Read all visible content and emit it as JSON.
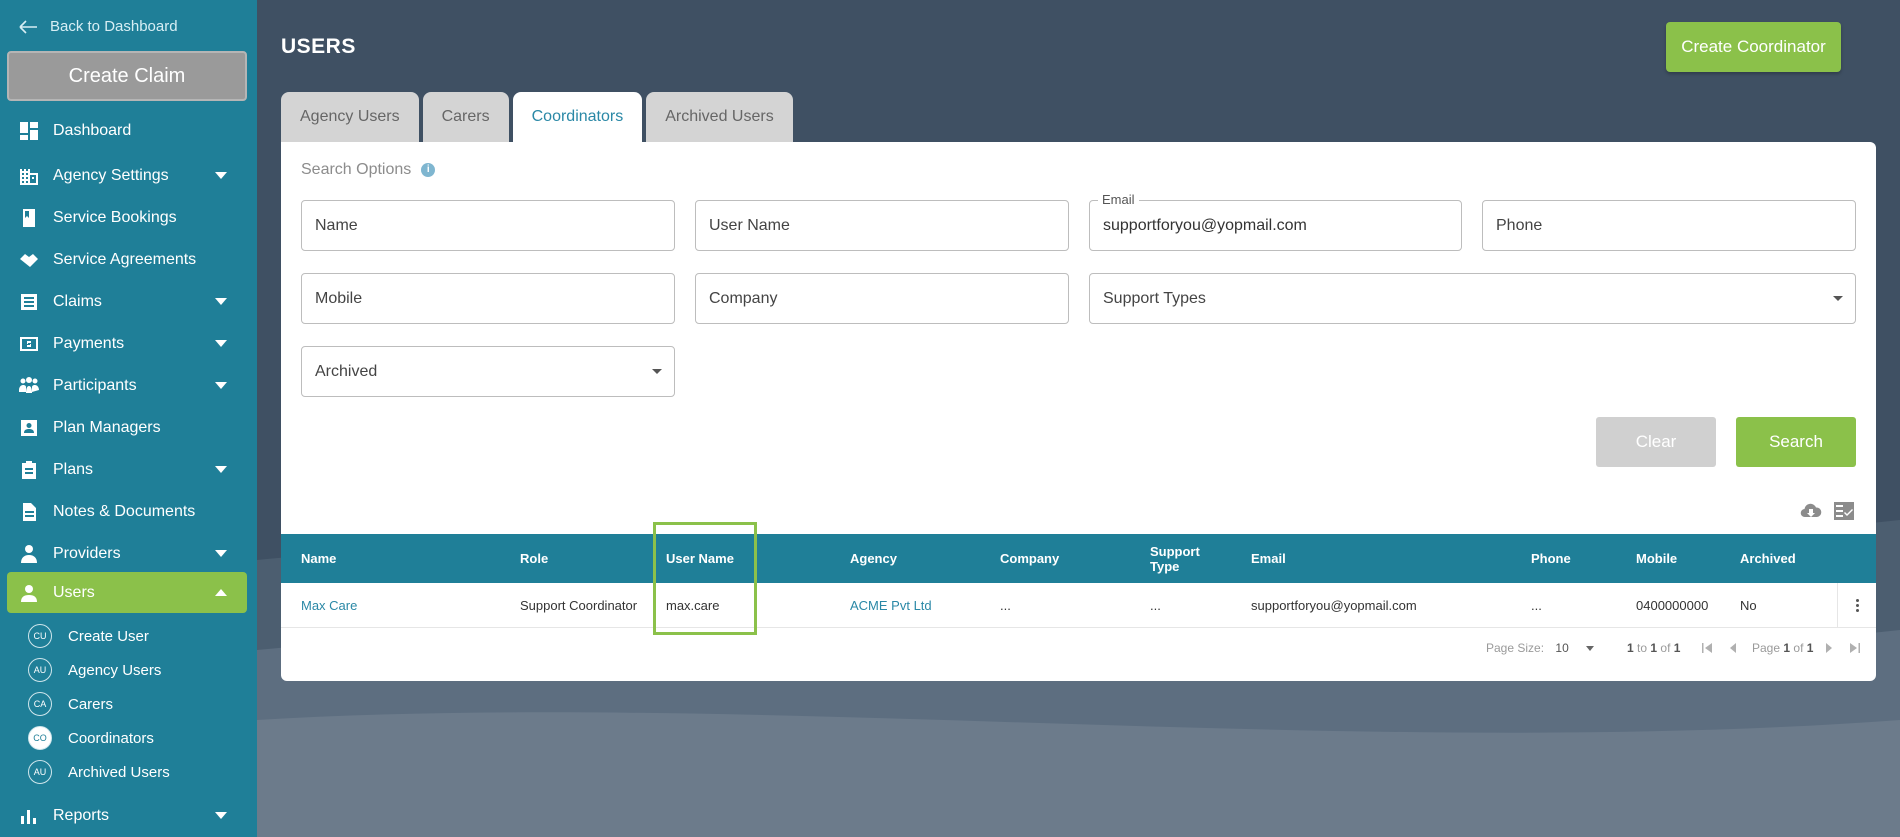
{
  "sidebar": {
    "back_label": "Back to Dashboard",
    "create_claim_label": "Create Claim",
    "items": [
      {
        "label": "Dashboard",
        "icon": "dashboard-icon",
        "expandable": false
      },
      {
        "label": "Agency Settings",
        "icon": "building-icon",
        "expandable": true
      },
      {
        "label": "Service Bookings",
        "icon": "bookmark-icon",
        "expandable": false
      },
      {
        "label": "Service Agreements",
        "icon": "handshake-icon",
        "expandable": false
      },
      {
        "label": "Claims",
        "icon": "list-icon",
        "expandable": true
      },
      {
        "label": "Payments",
        "icon": "money-icon",
        "expandable": true
      },
      {
        "label": "Participants",
        "icon": "people-icon",
        "expandable": true
      },
      {
        "label": "Plan Managers",
        "icon": "person-card-icon",
        "expandable": false
      },
      {
        "label": "Plans",
        "icon": "clipboard-icon",
        "expandable": true
      },
      {
        "label": "Notes & Documents",
        "icon": "document-icon",
        "expandable": false
      },
      {
        "label": "Providers",
        "icon": "provider-icon",
        "expandable": true
      },
      {
        "label": "Users",
        "icon": "user-icon",
        "expandable": true,
        "active": true
      },
      {
        "label": "Reports",
        "icon": "bar-chart-icon",
        "expandable": true
      }
    ],
    "sub_items": [
      {
        "badge": "CU",
        "label": "Create User"
      },
      {
        "badge": "AU",
        "label": "Agency Users"
      },
      {
        "badge": "CA",
        "label": "Carers"
      },
      {
        "badge": "CO",
        "label": "Coordinators",
        "active": true
      },
      {
        "badge": "AU",
        "label": "Archived Users"
      }
    ]
  },
  "header": {
    "title": "USERS",
    "create_button": "Create Coordinator"
  },
  "tabs": [
    "Agency Users",
    "Carers",
    "Coordinators",
    "Archived Users"
  ],
  "active_tab": "Coordinators",
  "search": {
    "title": "Search Options",
    "fields": {
      "name": {
        "placeholder": "Name",
        "value": ""
      },
      "username": {
        "placeholder": "User Name",
        "value": ""
      },
      "email": {
        "label": "Email",
        "value": "supportforyou@yopmail.com"
      },
      "phone": {
        "placeholder": "Phone",
        "value": ""
      },
      "mobile": {
        "placeholder": "Mobile",
        "value": ""
      },
      "company": {
        "placeholder": "Company",
        "value": ""
      },
      "support_types": {
        "placeholder": "Support Types",
        "value": ""
      },
      "archived": {
        "placeholder": "Archived",
        "value": ""
      }
    },
    "clear_label": "Clear",
    "search_label": "Search"
  },
  "table": {
    "columns": [
      "Name",
      "Role",
      "User Name",
      "Agency",
      "Company",
      "Support Type",
      "Email",
      "Phone",
      "Mobile",
      "Archived"
    ],
    "rows": [
      {
        "name": "Max Care",
        "role": "Support Coordinator",
        "username": "max.care",
        "agency": "ACME Pvt Ltd",
        "company": "...",
        "support_type": "...",
        "email": "supportforyou@yopmail.com",
        "phone": "...",
        "mobile": "0400000000",
        "archived": "No"
      }
    ]
  },
  "pagination": {
    "page_size_label": "Page Size:",
    "page_size": "10",
    "from": "1",
    "to_word": "to",
    "to": "1",
    "of_word": "of",
    "total": "1",
    "page_word": "Page",
    "page": "1",
    "page_of": "of",
    "pages": "1"
  },
  "colors": {
    "sidebar": "#1f7f98",
    "accent_green": "#8bc14a",
    "header_blue": "#1f7f98",
    "link": "#2a88a6"
  }
}
